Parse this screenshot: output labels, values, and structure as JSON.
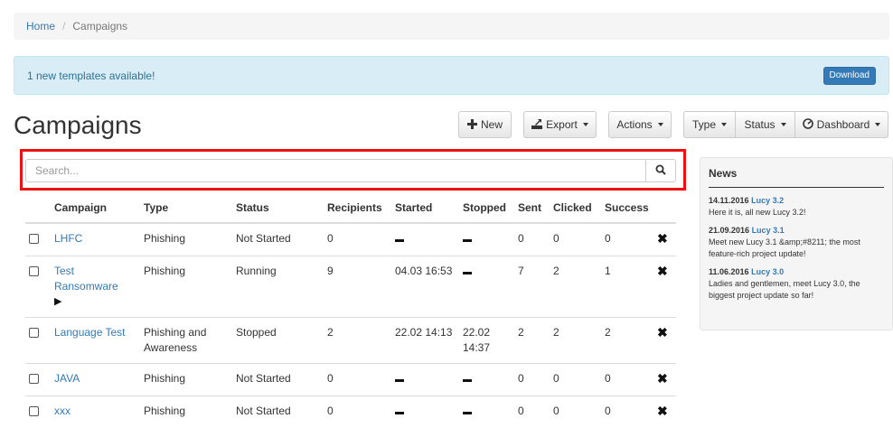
{
  "breadcrumb": {
    "home": "Home",
    "current": "Campaigns"
  },
  "alert": {
    "message": "1 new templates available!",
    "button": "Download"
  },
  "title": "Campaigns",
  "toolbar": {
    "new": "New",
    "export": "Export",
    "actions": "Actions",
    "type": "Type",
    "status": "Status",
    "dashboard": "Dashboard"
  },
  "search": {
    "placeholder": "Search..."
  },
  "table": {
    "headers": [
      "Campaign",
      "Type",
      "Status",
      "Recipients",
      "Started",
      "Stopped",
      "Sent",
      "Clicked",
      "Success"
    ],
    "rows": [
      {
        "campaign": "LHFC",
        "type": "Phishing",
        "status": "Not Started",
        "recipients": "0",
        "started": "",
        "stopped": "",
        "sent": "0",
        "clicked": "0",
        "success": "0",
        "running": false
      },
      {
        "campaign": "Test Ransomware",
        "type": "Phishing",
        "status": "Running",
        "recipients": "9",
        "started": "04.03 16:53",
        "stopped": "",
        "sent": "7",
        "clicked": "2",
        "success": "1",
        "running": true
      },
      {
        "campaign": "Language Test",
        "type": "Phishing and Awareness",
        "status": "Stopped",
        "recipients": "2",
        "started": "22.02 14:13",
        "stopped": "22.02 14:37",
        "sent": "2",
        "clicked": "2",
        "success": "2",
        "running": false
      },
      {
        "campaign": "JAVA",
        "type": "Phishing",
        "status": "Not Started",
        "recipients": "0",
        "started": "",
        "stopped": "",
        "sent": "0",
        "clicked": "0",
        "success": "0",
        "running": false
      },
      {
        "campaign": "xxx",
        "type": "Phishing",
        "status": "Not Started",
        "recipients": "0",
        "started": "",
        "stopped": "",
        "sent": "0",
        "clicked": "0",
        "success": "0",
        "running": false
      }
    ]
  },
  "news": {
    "title": "News",
    "items": [
      {
        "date": "14.11.2016",
        "version": "Lucy 3.2",
        "text": "Here it is, all new Lucy 3.2!"
      },
      {
        "date": "21.09.2016",
        "version": "Lucy 3.1",
        "text": "Meet new Lucy 3.1 &amp;#8211; the most feature-rich project update!"
      },
      {
        "date": "11.06.2016",
        "version": "Lucy 3.0",
        "text": "Ladies and gentlemen, meet Lucy 3.0, the biggest project update so far!"
      }
    ]
  },
  "icons": {
    "new": "plus-icon",
    "export": "export-icon",
    "dashboard": "dashboard-gauge-icon",
    "search": "search-icon",
    "delete": "delete-x-icon",
    "play": "play-icon"
  }
}
